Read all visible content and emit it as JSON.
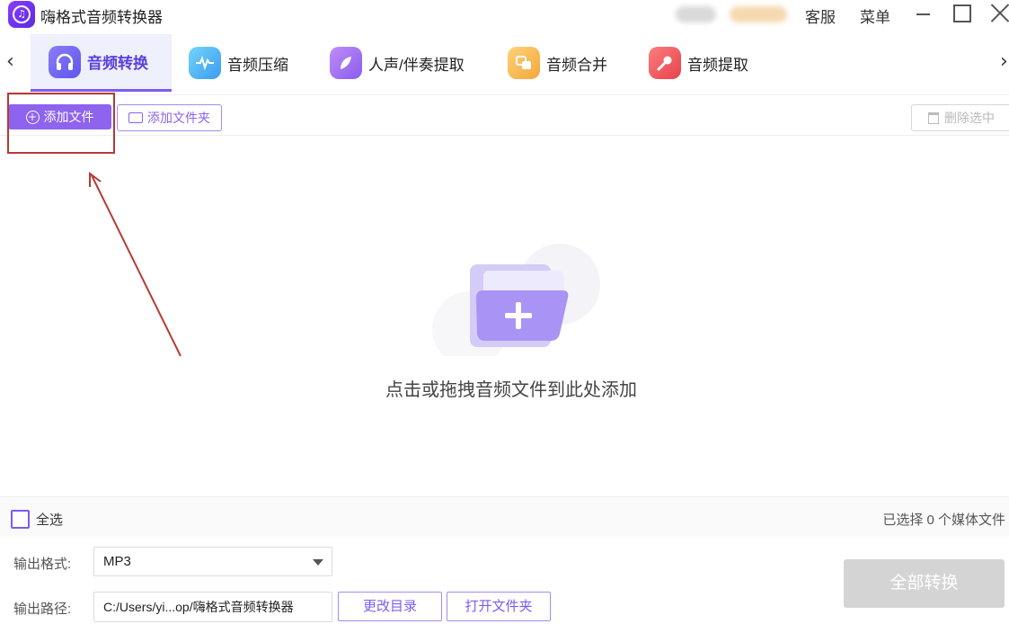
{
  "app": {
    "title": "嗨格式音频转换器",
    "logo_icon": "music-note-icon"
  },
  "titlebar": {
    "support_label": "客服",
    "menu_label": "菜单"
  },
  "tabs": [
    {
      "label": "音频转换",
      "icon": "headphones-icon",
      "color": "#6f63f2",
      "active": true
    },
    {
      "label": "音频压缩",
      "icon": "waveform-icon",
      "color": "#3fb0f0",
      "active": false
    },
    {
      "label": "人声/伴奏提取",
      "icon": "vocal-icon",
      "color": "#9d6af2",
      "active": false
    },
    {
      "label": "音频合并",
      "icon": "merge-icon",
      "color": "#f7b84a",
      "active": false
    },
    {
      "label": "音频提取",
      "icon": "microphone-icon",
      "color": "#f0545a",
      "active": false
    }
  ],
  "toolbar": {
    "add_file": "添加文件",
    "add_folder": "添加文件夹",
    "delete_selected": "删除选中"
  },
  "main": {
    "drop_hint": "点击或拖拽音频文件到此处添加"
  },
  "footer": {
    "select_all": "全选",
    "selected_count": "已选择 0 个媒体文件"
  },
  "settings": {
    "format_label": "输出格式:",
    "format_value": "MP3",
    "path_label": "输出路径:",
    "path_value": "C:/Users/yi...op/嗨格式音频转换器",
    "change_dir": "更改目录",
    "open_folder": "打开文件夹",
    "convert_all": "全部转换"
  },
  "colors": {
    "accent": "#8e63ee",
    "annotation": "#b53a36"
  }
}
